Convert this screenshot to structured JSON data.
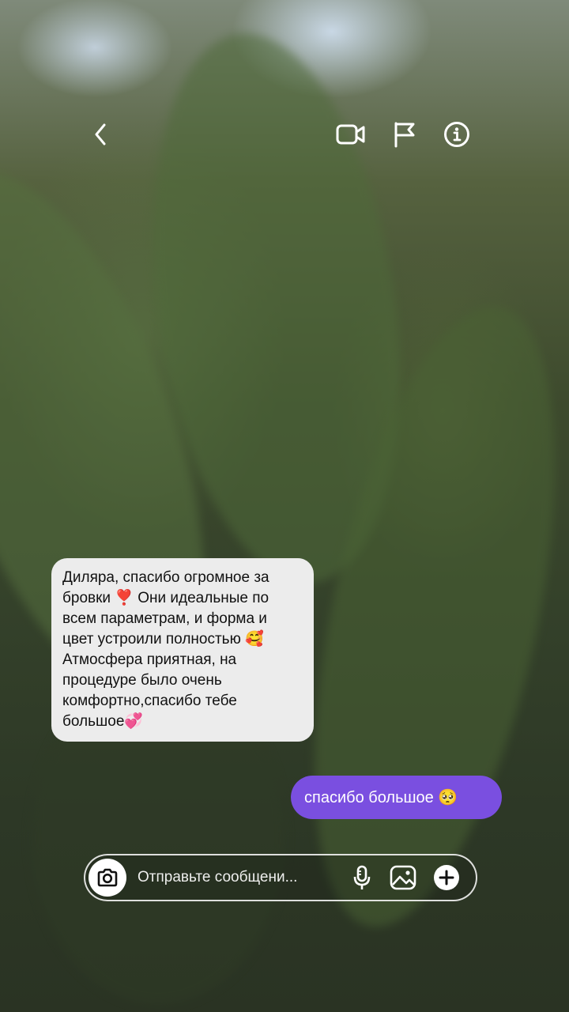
{
  "header": {
    "back_icon": "chevron-left-icon",
    "actions": [
      {
        "icon": "video-call-icon"
      },
      {
        "icon": "flag-icon"
      },
      {
        "icon": "info-icon"
      }
    ]
  },
  "messages": [
    {
      "direction": "incoming",
      "lines": [
        "Диляра, спасибо огромное за",
        "бровки ❣️ Они идеальные по",
        "всем параметрам, и форма и",
        "цвет устроили полностью 🥰",
        "Атмосфера приятная, на",
        "процедуре было очень",
        "комфортно,спасибо тебе",
        "большое💞"
      ]
    },
    {
      "direction": "outgoing",
      "text": "спасибо большое 🥺"
    }
  ],
  "composer": {
    "placeholder": "Отправьте сообщени...",
    "camera_icon": "camera-icon",
    "mic_icon": "microphone-icon",
    "gallery_icon": "image-icon",
    "plus_icon": "plus-icon"
  },
  "colors": {
    "outgoing_bubble": "#7a4fe0",
    "incoming_bubble": "#ececec",
    "icon_color": "#ffffff"
  }
}
